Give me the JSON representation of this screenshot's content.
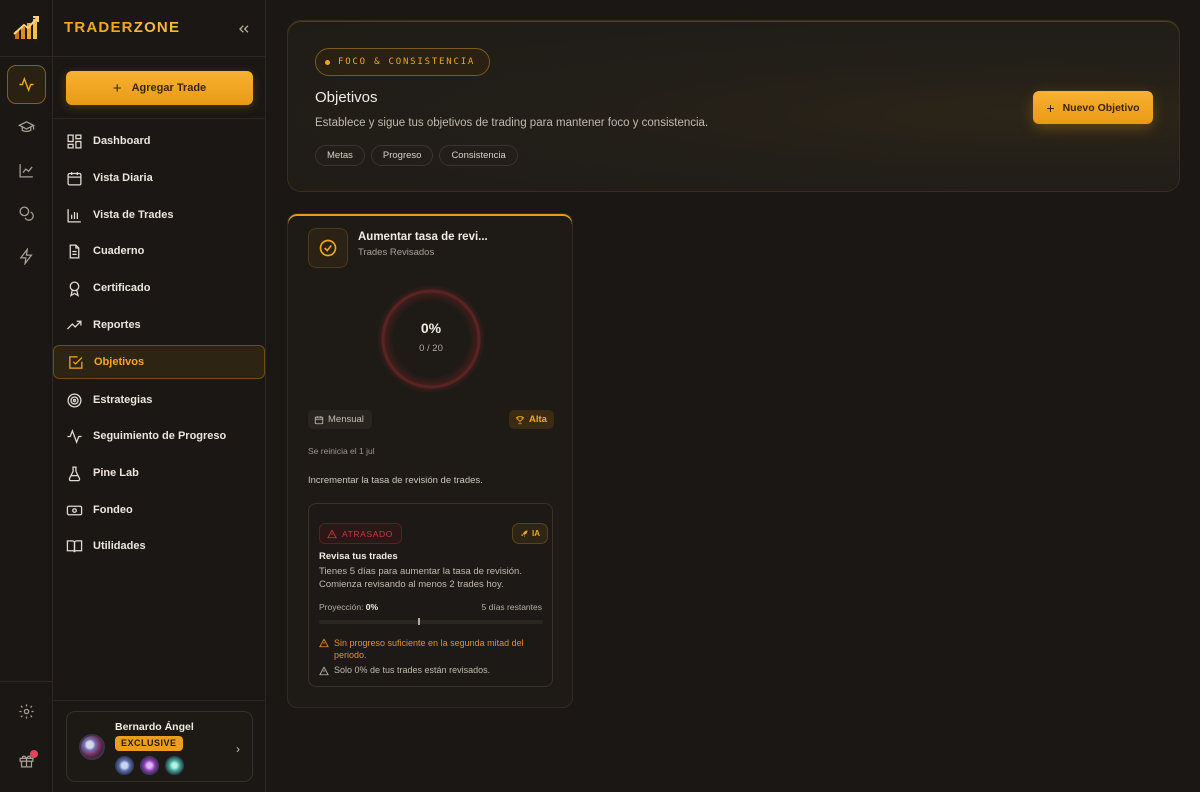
{
  "brand": {
    "part1": "TRADER",
    "part2": "ZONE"
  },
  "sidebar": {
    "add_trade_label": "Agregar Trade",
    "items": [
      {
        "label": "Dashboard",
        "icon": "dashboard-icon"
      },
      {
        "label": "Vista Diaria",
        "icon": "calendar-icon"
      },
      {
        "label": "Vista de Trades",
        "icon": "bar-chart-icon"
      },
      {
        "label": "Cuaderno",
        "icon": "notebook-icon"
      },
      {
        "label": "Certificado",
        "icon": "award-icon"
      },
      {
        "label": "Reportes",
        "icon": "trending-up-icon"
      },
      {
        "label": "Objetivos",
        "icon": "checkbox-icon",
        "active": true
      },
      {
        "label": "Estrategias",
        "icon": "target-icon"
      },
      {
        "label": "Seguimiento de Progreso",
        "icon": "activity-icon"
      },
      {
        "label": "Pine Lab",
        "icon": "flask-icon"
      },
      {
        "label": "Fondeo",
        "icon": "banknote-icon"
      },
      {
        "label": "Utilidades",
        "icon": "book-icon"
      }
    ]
  },
  "rail": {
    "items": [
      "activity-icon",
      "graduation-cap-icon",
      "line-chart-icon",
      "coins-icon",
      "zap-icon"
    ],
    "bottom": [
      "settings-icon",
      "gift-icon"
    ]
  },
  "user": {
    "name": "Bernardo Ángel",
    "badge": "EXCLUSIVE"
  },
  "header": {
    "pill": "FOCO & CONSISTENCIA",
    "title": "Objetivos",
    "subtitle": "Establece y sigue tus objetivos de trading para mantener foco y consistencia.",
    "tags": [
      "Metas",
      "Progreso",
      "Consistencia"
    ],
    "new_goal_label": "Nuevo Objetivo"
  },
  "goal": {
    "title": "Aumentar tasa de revi...",
    "subtitle": "Trades Revisados",
    "percent_label": "0%",
    "progress": 0,
    "count_label": "0 / 20",
    "period": "Mensual",
    "priority": "Alta",
    "reset": "Se reinicia el 1 jul",
    "description": "Incrementar la tasa de revisión de trades.",
    "insight": {
      "status": "ATRASADO",
      "ai_label": "IA",
      "title": "Revisa tus trades",
      "body": "Tienes 5 días para aumentar la tasa de revisión. Comienza revisando al menos 2 trades hoy.",
      "projection_label": "Proyección:",
      "projection_value": "0%",
      "remaining": "5 días restantes",
      "warning1": "Sin progreso suficiente en la segunda mitad del periodo.",
      "warning2": "Solo 0% de tus trades están revisados."
    }
  },
  "colors": {
    "accent": "#f0a623",
    "danger": "#c63a3a",
    "warning": "#e8902a"
  }
}
